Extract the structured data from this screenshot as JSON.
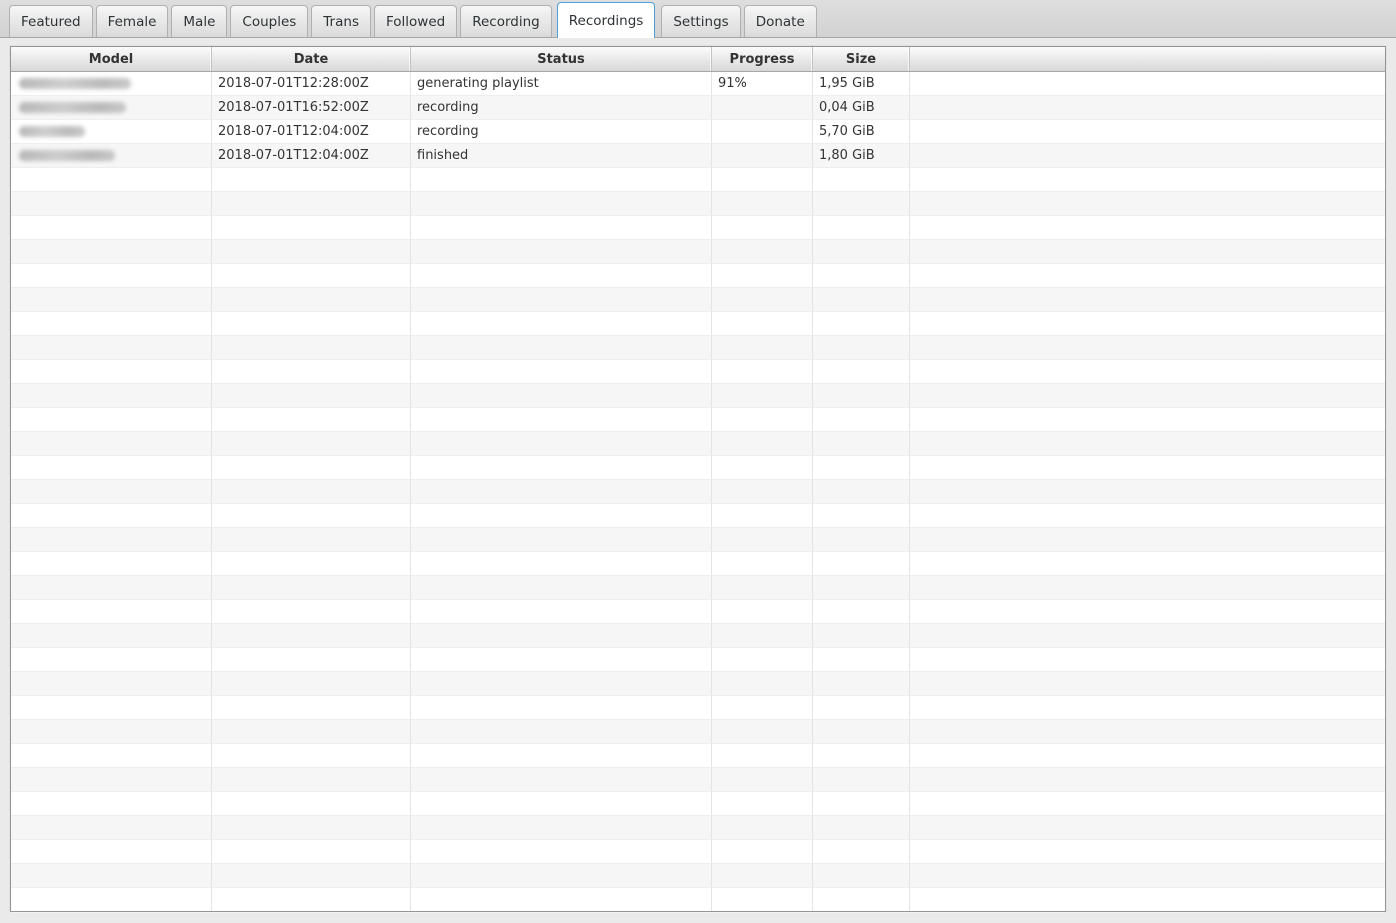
{
  "app": {
    "accent_blue": "#4e9edb",
    "window_background": "#eaeaea"
  },
  "tabs": [
    {
      "label": "Featured",
      "active": false
    },
    {
      "label": "Female",
      "active": false
    },
    {
      "label": "Male",
      "active": false
    },
    {
      "label": "Couples",
      "active": false
    },
    {
      "label": "Trans",
      "active": false
    },
    {
      "label": "Followed",
      "active": false
    },
    {
      "label": "Recording",
      "active": false
    },
    {
      "label": "Recordings",
      "active": true
    },
    {
      "label": "Settings",
      "active": false
    },
    {
      "label": "Donate",
      "active": false
    }
  ],
  "table": {
    "columns": [
      "Model",
      "Date",
      "Status",
      "Progress",
      "Size"
    ],
    "rows": [
      {
        "model_redacted": true,
        "redaction_width": 112,
        "date": "2018-07-01T12:28:00Z",
        "status": "generating playlist",
        "progress": "91%",
        "size": "1,95 GiB"
      },
      {
        "model_redacted": true,
        "redaction_width": 107,
        "date": "2018-07-01T16:52:00Z",
        "status": "recording",
        "progress": "",
        "size": "0,04 GiB"
      },
      {
        "model_redacted": true,
        "redaction_width": 66,
        "date": "2018-07-01T12:04:00Z",
        "status": "recording",
        "progress": "",
        "size": "5,70 GiB"
      },
      {
        "model_redacted": true,
        "redaction_width": 96,
        "date": "2018-07-01T12:04:00Z",
        "status": "finished",
        "progress": "",
        "size": "1,80 GiB"
      }
    ],
    "empty_row_count": 31
  }
}
